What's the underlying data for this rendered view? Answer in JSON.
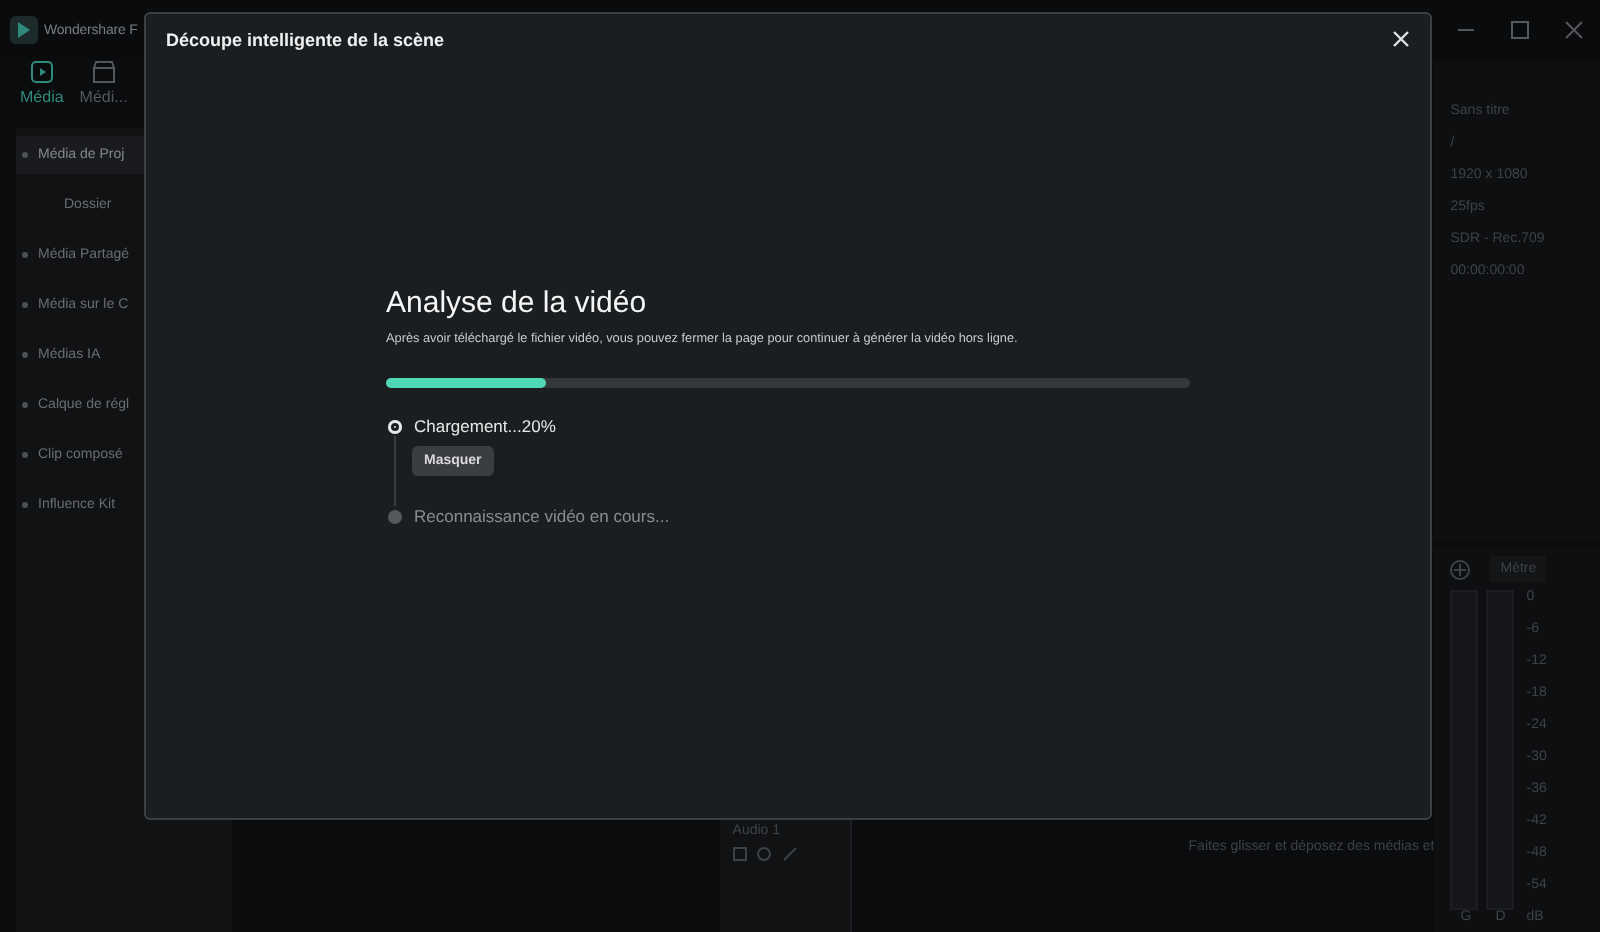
{
  "app": {
    "name": "Wondershare F"
  },
  "top_tabs": [
    {
      "label": "Média",
      "selected": true
    },
    {
      "label": "Médi...",
      "selected": false
    }
  ],
  "sidebar": {
    "items": [
      {
        "label": "Média de Proj",
        "selected": true
      },
      {
        "label": "Dossier",
        "selected": false,
        "kind": "sub"
      },
      {
        "label": "Média Partagé",
        "selected": false
      },
      {
        "label": "Média sur le C",
        "selected": false
      },
      {
        "label": "Médias IA",
        "selected": false
      },
      {
        "label": "Calque de régl",
        "selected": false
      },
      {
        "label": "Clip composé",
        "selected": false
      },
      {
        "label": "Influence Kit",
        "selected": false
      }
    ]
  },
  "project_info": [
    "Sans titre",
    "/",
    "1920 x 1080",
    "25fps",
    "SDR - Rec.709",
    "00:00:00:00"
  ],
  "meter": {
    "dropdown": "Mètre",
    "ticks": [
      "0",
      "-6",
      "-12",
      "-18",
      "-24",
      "-30",
      "-36",
      "-42",
      "-48",
      "-54",
      "dB"
    ],
    "channels": [
      "G",
      "D"
    ]
  },
  "timeline": {
    "track": "Audio 1",
    "hint": "Faites glisser et déposez des médias et"
  },
  "dialog": {
    "title": "Découpe intelligente de la scène",
    "heading": "Analyse de la vidéo",
    "subtitle": "Après avoir téléchargé le fichier vidéo, vous pouvez fermer la page pour continuer à générer la vidéo hors ligne.",
    "progress": {
      "level": 0.2
    },
    "steps": [
      {
        "label": "Chargement...20%",
        "active": true,
        "button": "Masquer"
      },
      {
        "label": "Reconnaissance vidéo en cours...",
        "active": false
      }
    ]
  }
}
